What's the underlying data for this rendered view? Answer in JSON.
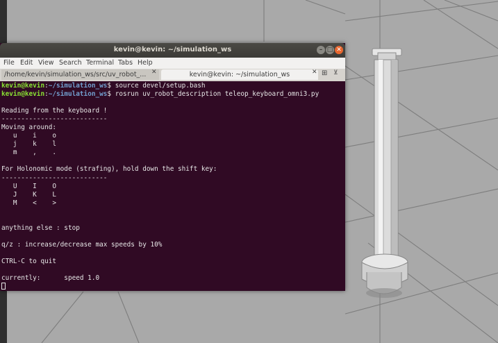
{
  "window": {
    "title": "kevin@kevin: ~/simulation_ws",
    "controls": {
      "minimize": "–",
      "maximize": "□",
      "close": "✕"
    }
  },
  "menu": [
    "File",
    "Edit",
    "View",
    "Search",
    "Terminal",
    "Tabs",
    "Help"
  ],
  "tabs": [
    {
      "label": "/home/kevin/simulation_ws/src/uv_robot_...",
      "close": "✕"
    },
    {
      "label": "kevin@kevin: ~/simulation_ws",
      "close": "✕"
    }
  ],
  "tab_actions": {
    "new_tab": "⊞",
    "menu": "⊻"
  },
  "prompts": [
    {
      "user": "kevin@kevin",
      "sep": ":",
      "path": "~/simulation_ws",
      "symbol": "$ ",
      "command": "source devel/setup.bash"
    },
    {
      "user": "kevin@kevin",
      "sep": ":",
      "path": "~/simulation_ws",
      "symbol": "$ ",
      "command": "rosrun uv_robot_description teleop_keyboard_omni3.py"
    }
  ],
  "output_lines": [
    "",
    "Reading from the keyboard !",
    "---------------------------",
    "Moving around:",
    "   u    i    o",
    "   j    k    l",
    "   m    ,    .",
    "",
    "For Holonomic mode (strafing), hold down the shift key:",
    "---------------------------",
    "   U    I    O",
    "   J    K    L",
    "   M    <    >",
    "",
    "",
    "anything else : stop",
    "",
    "q/z : increase/decrease max speeds by 10%",
    "",
    "CTRL-C to quit",
    "",
    "currently:      speed 1.0"
  ],
  "colors": {
    "terminal_bg": "#300a24",
    "prompt_user": "#8ae234",
    "prompt_path": "#729fcf",
    "text": "#e6e6e6",
    "sim_background": "#a9a9a9",
    "grid_line": "#7d7d7d"
  }
}
